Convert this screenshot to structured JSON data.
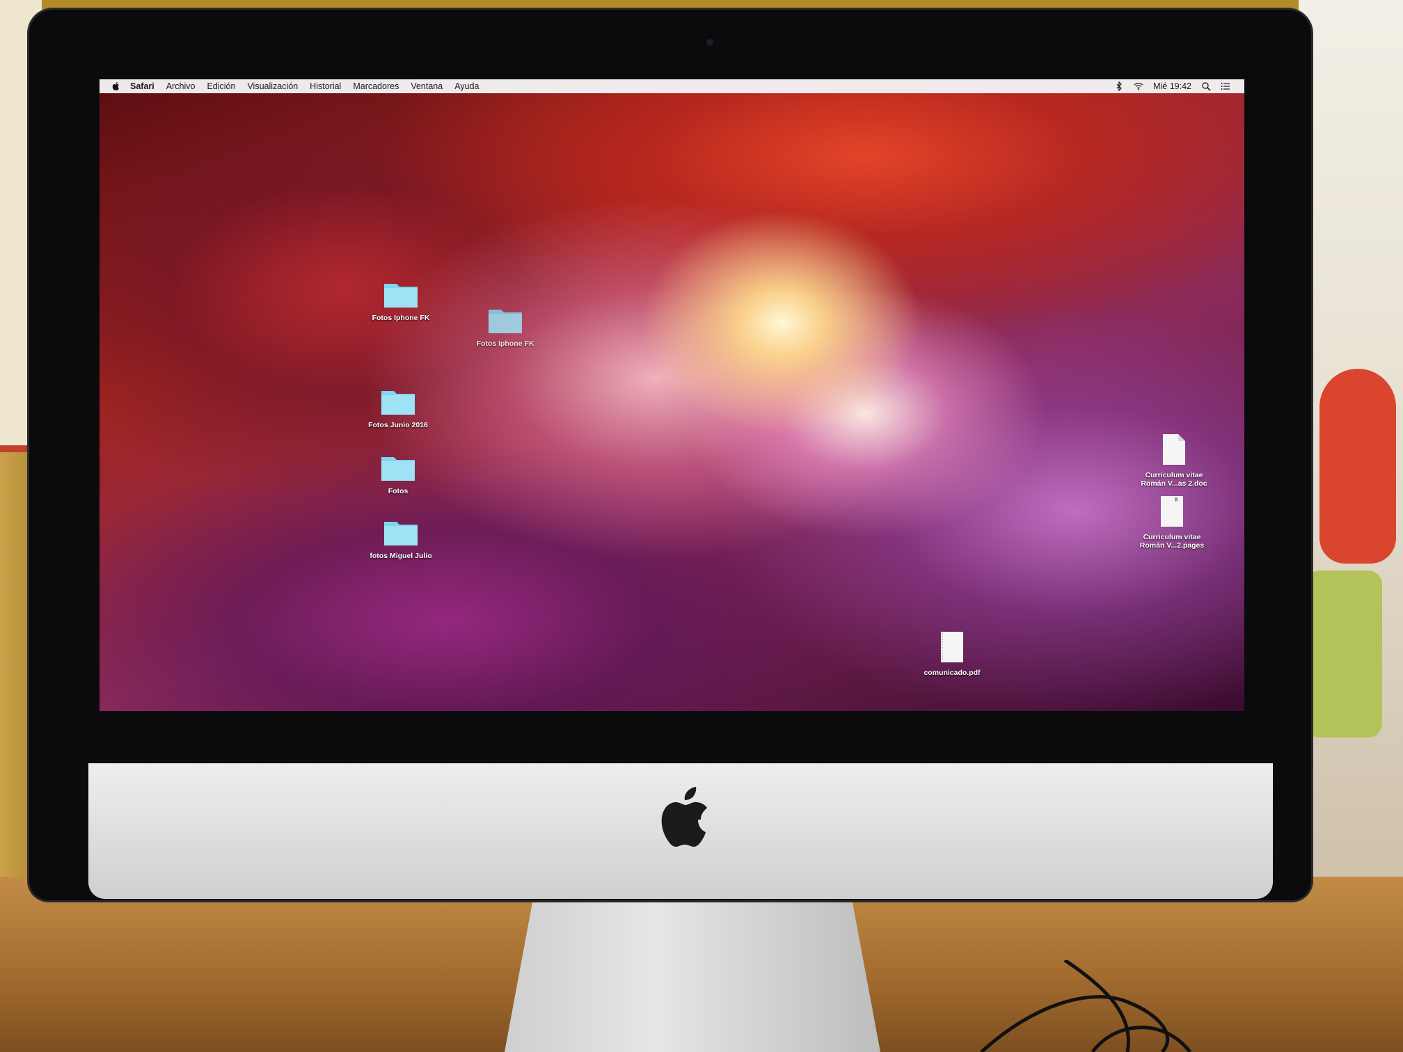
{
  "menubar": {
    "app_name": "Safari",
    "menus": [
      "Archivo",
      "Edición",
      "Visualización",
      "Historial",
      "Marcadores",
      "Ventana",
      "Ayuda"
    ],
    "clock": "Mié 19:42",
    "status_icons": [
      "bluetooth-icon",
      "wifi-icon",
      "spotlight-icon",
      "notification-center-icon"
    ]
  },
  "desktop": {
    "folders": [
      {
        "name": "Fotos Iphone FK"
      },
      {
        "name": "Fotos Iphone FK"
      },
      {
        "name": "Fotos Junio 2016"
      },
      {
        "name": "Fotos"
      },
      {
        "name": "fotos Miguel Julio"
      }
    ],
    "files": [
      {
        "name_line1": "Curriculum vitae",
        "name_line2": "Román V...as 2.doc",
        "icon": "doc-icon"
      },
      {
        "name_line1": "Curriculum vitae",
        "name_line2": "Román V...2.pages",
        "icon": "pages-icon"
      },
      {
        "name_line1": "comunicado.pdf",
        "name_line2": "",
        "icon": "pdf-icon"
      }
    ]
  },
  "colors": {
    "folder": "#7fd6ef",
    "menubar_bg": "#f4f4f6"
  }
}
